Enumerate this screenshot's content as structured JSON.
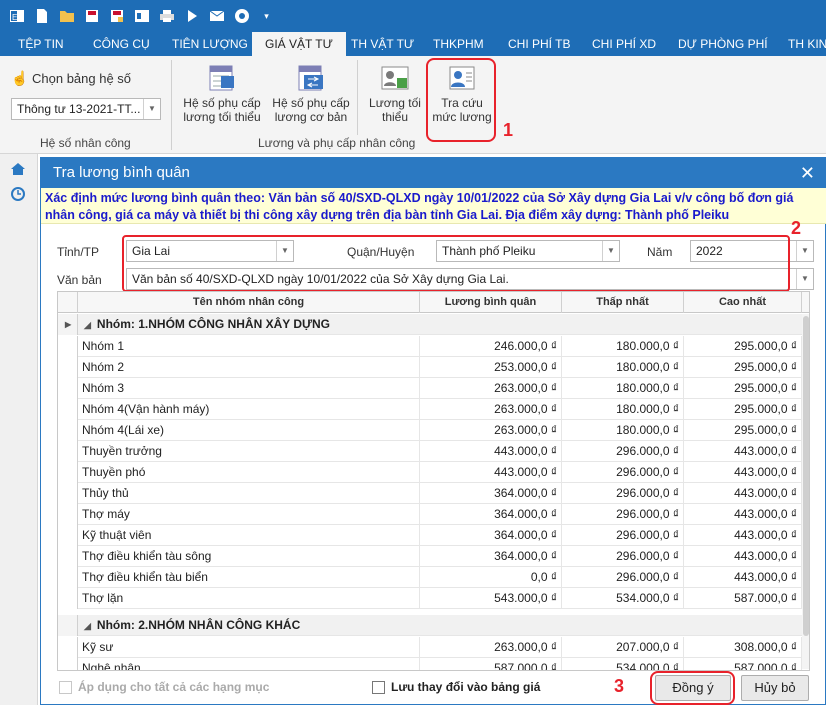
{
  "qat": {
    "icons": [
      "excel-icon",
      "new-file-icon",
      "open-folder-icon",
      "save-icon",
      "save-as-icon",
      "print-preview-icon",
      "print-icon",
      "run-icon",
      "email-icon",
      "help-icon",
      "customize-icon"
    ]
  },
  "tabs": [
    "TỆP TIN",
    "CÔNG CỤ",
    "TIÊN LƯỢNG",
    "GIÁ VẬT TƯ",
    "TH VẬT TƯ",
    "THKPHM",
    "CHI PHÍ TB",
    "CHI PHÍ XD",
    "DỰ PHÒNG PHÍ",
    "TH KINH"
  ],
  "active_tab": "GIÁ VẬT TƯ",
  "ribbon": {
    "choose_label": "Chọn bảng hệ số",
    "choose_value": "Thông tư 13-2021-TT...",
    "group1_label": "Hệ số nhân công",
    "btn1_l1": "Hệ số phụ cấp",
    "btn1_l2": "lương tối thiểu",
    "btn2_l1": "Hệ số phụ cấp",
    "btn2_l2": "lương cơ bản",
    "btn3_l1": "Lương tối",
    "btn3_l2": "thiểu",
    "btn4_l1": "Tra cứu",
    "btn4_l2": "mức lương",
    "group2_label": "Lương và phụ cấp nhân công"
  },
  "markers": {
    "m1": "1",
    "m2": "2",
    "m3": "3"
  },
  "dialog": {
    "title": "Tra lương bình quân",
    "close": "✕",
    "notice": "Xác định mức lương bình quân theo: Văn bản số 40/SXD-QLXD ngày 10/01/2022 của Sở Xây dựng Gia Lai v/v công bố đơn giá nhân công, giá ca máy và thiết bị thi công xây dựng trên địa bàn tỉnh Gia Lai. Địa điểm xây dựng: Thành phố Pleiku",
    "province_label": "Tỉnh/TP",
    "province_value": "Gia Lai",
    "district_label": "Quận/Huyện",
    "district_value": "Thành phố Pleiku",
    "year_label": "Năm",
    "year_value": "2022",
    "doc_label": "Văn bản",
    "doc_value": "Văn bản số 40/SXD-QLXD ngày 10/01/2022 của Sở Xây dựng Gia Lai.",
    "apply_all": "Áp dụng cho tất cả các hạng mục",
    "save_changes": "Lưu thay đổi vào bảng giá",
    "ok": "Đồng ý",
    "cancel": "Hủy bỏ"
  },
  "grid": {
    "columns": [
      "Tên nhóm nhân công",
      "Lương bình quân",
      "Thấp nhất",
      "Cao nhất"
    ],
    "rows": [
      {
        "type": "group",
        "name": "Nhóm: 1.NHÓM CÔNG NHÂN XÂY DỰNG"
      },
      {
        "type": "row",
        "name": "Nhóm 1",
        "avg": "246.000,0 ₫",
        "min": "180.000,0 ₫",
        "max": "295.000,0 ₫"
      },
      {
        "type": "row",
        "name": "Nhóm 2",
        "avg": "253.000,0 ₫",
        "min": "180.000,0 ₫",
        "max": "295.000,0 ₫"
      },
      {
        "type": "row",
        "name": "Nhóm 3",
        "avg": "263.000,0 ₫",
        "min": "180.000,0 ₫",
        "max": "295.000,0 ₫"
      },
      {
        "type": "row",
        "name": "Nhóm 4(Vận hành máy)",
        "avg": "263.000,0 ₫",
        "min": "180.000,0 ₫",
        "max": "295.000,0 ₫"
      },
      {
        "type": "row",
        "name": "Nhóm 4(Lái xe)",
        "avg": "263.000,0 ₫",
        "min": "180.000,0 ₫",
        "max": "295.000,0 ₫"
      },
      {
        "type": "row",
        "name": "Thuyền trưởng",
        "avg": "443.000,0 ₫",
        "min": "296.000,0 ₫",
        "max": "443.000,0 ₫"
      },
      {
        "type": "row",
        "name": "Thuyền phó",
        "avg": "443.000,0 ₫",
        "min": "296.000,0 ₫",
        "max": "443.000,0 ₫"
      },
      {
        "type": "row",
        "name": "Thủy thủ",
        "avg": "364.000,0 ₫",
        "min": "296.000,0 ₫",
        "max": "443.000,0 ₫"
      },
      {
        "type": "row",
        "name": "Thợ máy",
        "avg": "364.000,0 ₫",
        "min": "296.000,0 ₫",
        "max": "443.000,0 ₫"
      },
      {
        "type": "row",
        "name": "Kỹ thuật viên",
        "avg": "364.000,0 ₫",
        "min": "296.000,0 ₫",
        "max": "443.000,0 ₫"
      },
      {
        "type": "row",
        "name": "Thợ điều khiển tàu sông",
        "avg": "364.000,0 ₫",
        "min": "296.000,0 ₫",
        "max": "443.000,0 ₫"
      },
      {
        "type": "row",
        "name": "Thợ điều khiển tàu biển",
        "avg": "0,0 ₫",
        "min": "296.000,0 ₫",
        "max": "443.000,0 ₫"
      },
      {
        "type": "row",
        "name": "Thợ lặn",
        "avg": "543.000,0 ₫",
        "min": "534.000,0 ₫",
        "max": "587.000,0 ₫"
      },
      {
        "type": "group",
        "name": "Nhóm: 2.NHÓM NHÂN CÔNG KHÁC"
      },
      {
        "type": "row",
        "name": "Kỹ sư",
        "avg": "263.000,0 ₫",
        "min": "207.000,0 ₫",
        "max": "308.000,0 ₫"
      },
      {
        "type": "row",
        "name": "Nghệ nhân",
        "avg": "587.000,0 ₫",
        "min": "534.000,0 ₫",
        "max": "587.000,0 ₫"
      }
    ]
  }
}
